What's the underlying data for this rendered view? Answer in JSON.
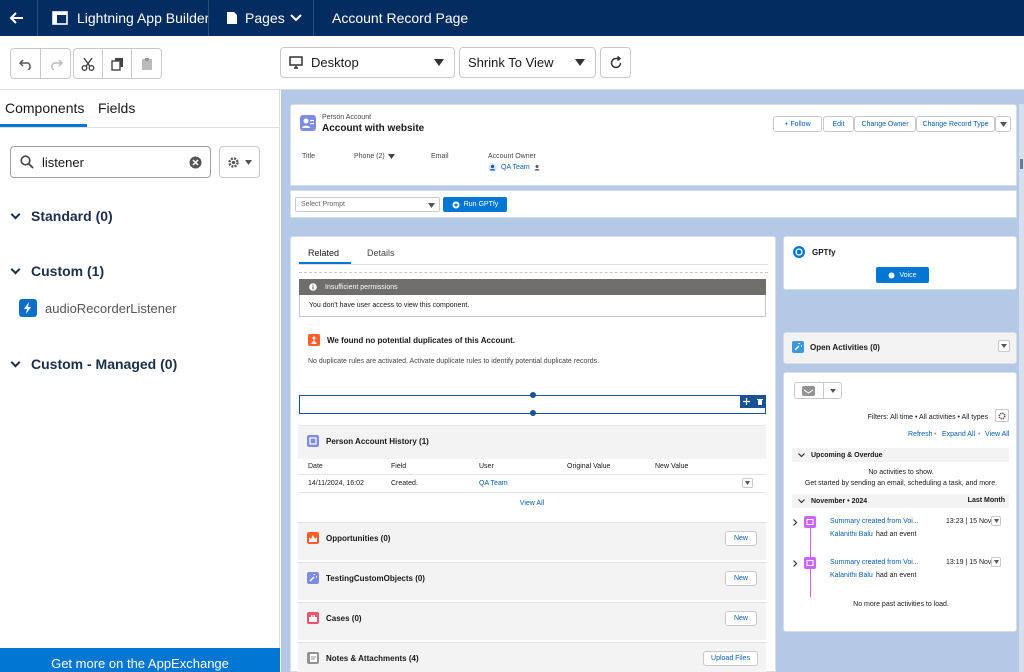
{
  "topbar": {
    "app_name": "Lightning App Builder",
    "pages_label": "Pages",
    "page_title": "Account Record Page"
  },
  "toolbar": {
    "device_select": "Desktop",
    "view_select": "Shrink To View"
  },
  "left_panel": {
    "tabs": [
      "Components",
      "Fields"
    ],
    "search_value": "listener",
    "sections": [
      {
        "label": "Standard (0)"
      },
      {
        "label": "Custom (1)",
        "items": [
          "audioRecorderListener"
        ]
      },
      {
        "label": "Custom - Managed (0)"
      }
    ],
    "appexchange": "Get more on the AppExchange"
  },
  "record": {
    "object_label": "Person Account",
    "name": "Account with website",
    "actions": [
      "+ Follow",
      "Edit",
      "Change Owner",
      "Change Record Type"
    ],
    "fields": {
      "title": "Title",
      "phone": "Phone (2)",
      "email": "Email",
      "owner_label": "Account Owner",
      "owner_value": "QA Team"
    },
    "prompt_placeholder": "Select Prompt",
    "run_button": "Run GPTfy"
  },
  "related": {
    "tabs": [
      "Related",
      "Details"
    ],
    "insufficient_title": "Insufficient permissions",
    "insufficient_msg": "You don't have user access to view this component.",
    "dup_title": "We found no potential duplicates of this Account.",
    "dup_msg": "No duplicate rules are activated. Activate duplicate rules to identify potential duplicate records.",
    "history": {
      "title": "Person Account History (1)",
      "columns": [
        "Date",
        "Field",
        "User",
        "Original Value",
        "New Value"
      ],
      "row": [
        "14/11/2024, 16:02",
        "Created.",
        "QA Team",
        "",
        ""
      ],
      "view_all": "View All"
    },
    "lists": [
      {
        "title": "Opportunities (0)",
        "button": "New",
        "color": "#ff5d2d"
      },
      {
        "title": "TestingCustomObjects (0)",
        "button": "New",
        "color": "#7f8de1"
      },
      {
        "title": "Cases (0)",
        "button": "New",
        "color": "#f2536d"
      },
      {
        "title": "Notes & Attachments (4)",
        "button": "Upload Files",
        "color": "#939393"
      }
    ]
  },
  "gptfy": {
    "title": "GPTfy",
    "voice_button": "Voice"
  },
  "activities": {
    "title": "Open Activities (0)",
    "filters": "Filters: All time • All activities • All types",
    "links": [
      "Refresh",
      "Expand All",
      "View All"
    ],
    "upcoming": "Upcoming & Overdue",
    "no_activities": "No activities to show.",
    "get_started": "Get started by sending an email, scheduling a task, and more.",
    "month": "November • 2024",
    "last_month": "Last Month",
    "events": [
      {
        "title": "Summary created from Voi...",
        "time": "13:23 | 15 Nov",
        "who": "Kalanithi Balu",
        "action": "had an event"
      },
      {
        "title": "Summary created from Voi...",
        "time": "13:19 | 15 Nov",
        "who": "Kalanithi Balu",
        "action": "had an event"
      }
    ],
    "no_more": "No more past activities to load."
  }
}
